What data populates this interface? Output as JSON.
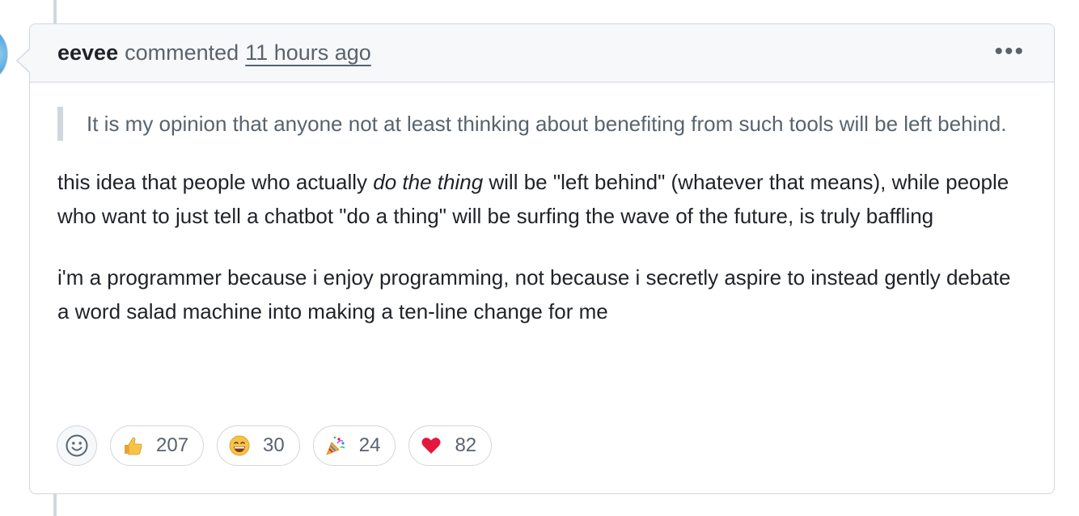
{
  "comment": {
    "author": "eevee",
    "action": "commented",
    "timestamp": "11 hours ago",
    "menu_icon": "kebab-horizontal-icon",
    "quote": "It is my opinion that anyone not at least thinking about benefiting from such tools will be left behind.",
    "paragraph1": {
      "before": "this idea that people who actually ",
      "emphasis": "do the thing",
      "after": " will be \"left behind\" (whatever that means), while people who want to just tell a chatbot \"do a thing\" will be surfing the wave of the future, is truly baffling"
    },
    "paragraph2": "i'm a programmer because i enjoy programming, not because i secretly aspire to instead gently debate a word salad machine into making a ten-line change for me"
  },
  "reactions": {
    "add_icon": "smiley-icon",
    "items": [
      {
        "icon": "thumbs-up-icon",
        "count": "207"
      },
      {
        "icon": "laugh-icon",
        "count": "30"
      },
      {
        "icon": "hooray-icon",
        "count": "24"
      },
      {
        "icon": "heart-icon",
        "count": "82"
      }
    ]
  },
  "colors": {
    "border": "#d0d7de",
    "header_bg": "#f6f8fa",
    "muted_text": "#59636e",
    "text": "#1f2328",
    "heart": "#e5173f"
  }
}
